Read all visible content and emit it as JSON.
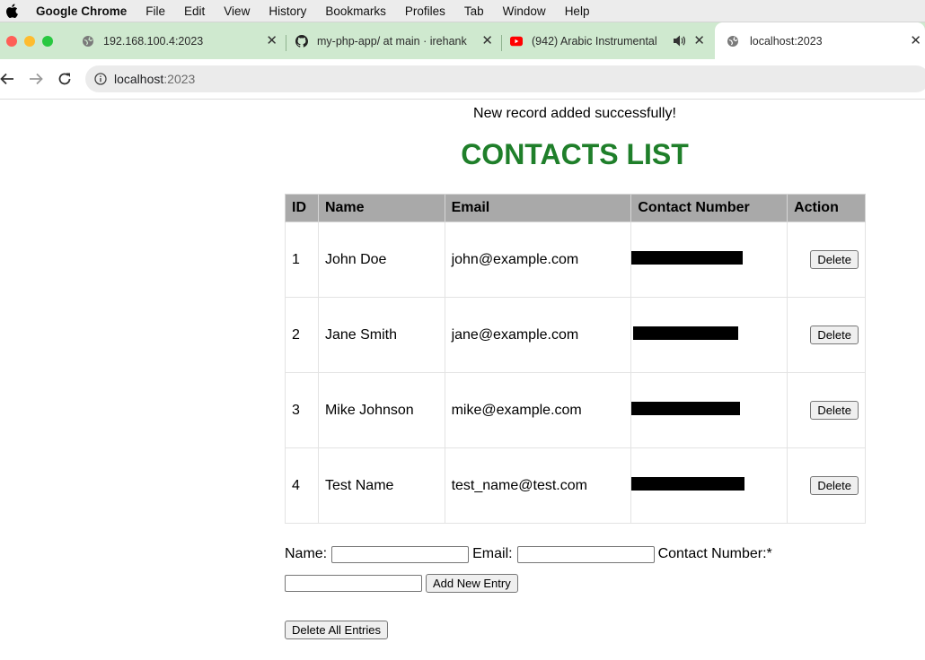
{
  "menubar": {
    "app": "Google Chrome",
    "items": [
      "File",
      "Edit",
      "View",
      "History",
      "Bookmarks",
      "Profiles",
      "Tab",
      "Window",
      "Help"
    ]
  },
  "tabs": [
    {
      "title": "192.168.100.4:2023",
      "icon": "globe-icon"
    },
    {
      "title": "my-php-app/ at main · irehank",
      "icon": "github-icon"
    },
    {
      "title": "(942) Arabic Instrumental",
      "icon": "youtube-icon"
    },
    {
      "title": "localhost:2023",
      "icon": "globe-icon"
    }
  ],
  "address": {
    "host": "localhost",
    "port": ":2023"
  },
  "page": {
    "message": "New record added successfully!",
    "heading": "CONTACTS LIST",
    "columns": [
      "ID",
      "Name",
      "Email",
      "Contact Number",
      "Action"
    ],
    "rows": [
      {
        "id": "1",
        "name": "John Doe",
        "email": "john@example.com",
        "action": "Delete"
      },
      {
        "id": "2",
        "name": "Jane Smith",
        "email": "jane@example.com",
        "action": "Delete"
      },
      {
        "id": "3",
        "name": "Mike Johnson",
        "email": "mike@example.com",
        "action": "Delete"
      },
      {
        "id": "4",
        "name": "Test Name",
        "email": "test_name@test.com",
        "action": "Delete"
      }
    ],
    "form": {
      "name_label": "Name:",
      "email_label": "Email:",
      "contact_label": "Contact Number:*",
      "name_value": "",
      "email_value": "",
      "contact_value": "",
      "add_button": "Add New Entry",
      "delete_all_button": "Delete All Entries"
    }
  },
  "colors": {
    "heading": "#1f7f2a",
    "tabstrip": "#cfe9cf",
    "table_header": "#a9a9a9"
  }
}
